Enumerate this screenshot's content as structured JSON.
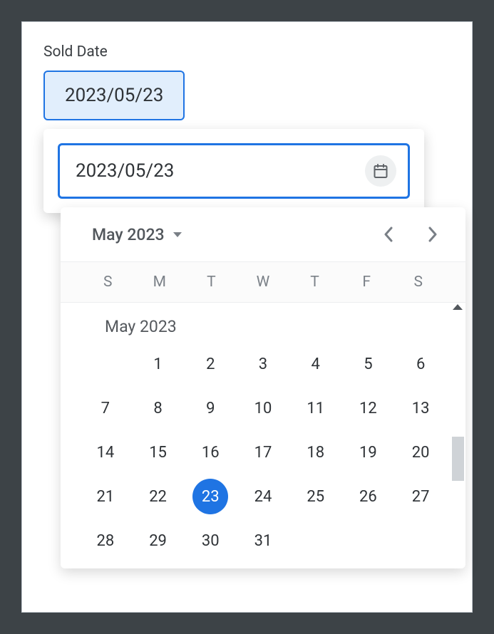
{
  "field": {
    "label": "Sold Date",
    "chip_value": "2023/05/23"
  },
  "picker": {
    "input_value": "2023/05/23"
  },
  "calendar": {
    "header_title": "May 2023",
    "weekdays": [
      "S",
      "M",
      "T",
      "W",
      "T",
      "F",
      "S"
    ],
    "month_label": "May 2023",
    "selected_day": 23,
    "days": [
      [
        "",
        "1",
        "2",
        "3",
        "4",
        "5",
        "6"
      ],
      [
        "7",
        "8",
        "9",
        "10",
        "11",
        "12",
        "13"
      ],
      [
        "14",
        "15",
        "16",
        "17",
        "18",
        "19",
        "20"
      ],
      [
        "21",
        "22",
        "23",
        "24",
        "25",
        "26",
        "27"
      ],
      [
        "28",
        "29",
        "30",
        "31",
        "",
        "",
        ""
      ]
    ]
  },
  "colors": {
    "accent": "#1f74e3",
    "chip_bg": "#e1eefc"
  }
}
